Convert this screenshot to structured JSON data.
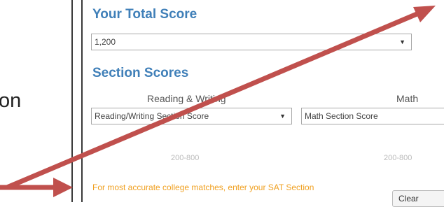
{
  "slide": {
    "partial_word": "on"
  },
  "calculator": {
    "total_heading": "Your Total Score",
    "total_select_value": "1,200",
    "sections_heading": "Section Scores",
    "reading_label": "Reading & Writing",
    "reading_select_placeholder": "Reading/Writing Section Score",
    "math_label": "Math",
    "math_select_placeholder": "Math Section Score",
    "reading_range_hint": "200-800",
    "math_range_hint": "200-800",
    "note": "For most accurate college matches, enter your SAT Section",
    "clear_button": "Clear"
  },
  "annotation": {
    "arrow_color": "#c0504d"
  }
}
